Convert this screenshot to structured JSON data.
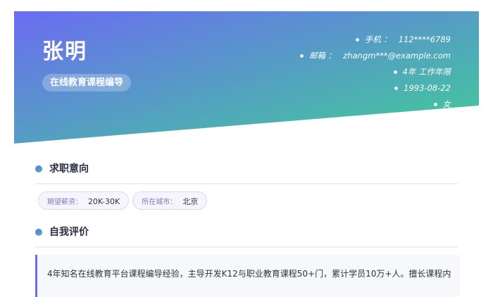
{
  "profile": {
    "name": "张明",
    "job_title": "在线教育课程编导"
  },
  "contact": [
    {
      "label": "手机 ：",
      "value": "112****6789"
    },
    {
      "label": "邮箱 ：",
      "value": "zhangm***@example.com"
    },
    {
      "label": "",
      "value": "4年 工作年限"
    },
    {
      "label": "",
      "value": "1993-08-22"
    },
    {
      "label": "",
      "value": "女"
    }
  ],
  "sections": {
    "intent": {
      "title": "求职意向",
      "tags": [
        {
          "key": "期望薪资：",
          "value": "20K-30K"
        },
        {
          "key": "所在城市：",
          "value": "北京"
        }
      ]
    },
    "evaluation": {
      "title": "自我评价",
      "text": "4年知名在线教育平台课程编导经验，主导开发K12与职业教育课程50+门，累计学员10万+人。擅长课程内"
    }
  },
  "colors": {
    "gradient_start": "#6b6cf2",
    "gradient_end": "#3fcf95",
    "accent": "#6b6cf2"
  }
}
